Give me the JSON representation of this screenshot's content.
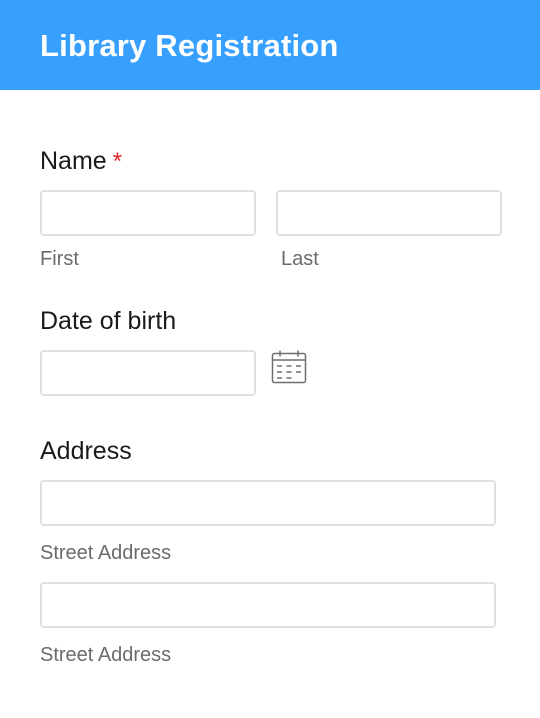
{
  "header": {
    "title": "Library Registration",
    "background_color": "#379ffd"
  },
  "name_field": {
    "label": "Name",
    "required_marker": "*",
    "required_color": "#e02424",
    "first": {
      "value": "",
      "sublabel": "First"
    },
    "last": {
      "value": "",
      "sublabel": "Last"
    }
  },
  "dob_field": {
    "label": "Date of birth",
    "value": "",
    "icon": "calendar-icon"
  },
  "address_field": {
    "label": "Address",
    "line1": {
      "value": "",
      "sublabel": "Street Address"
    },
    "line2": {
      "value": "",
      "sublabel": "Street Address"
    }
  }
}
